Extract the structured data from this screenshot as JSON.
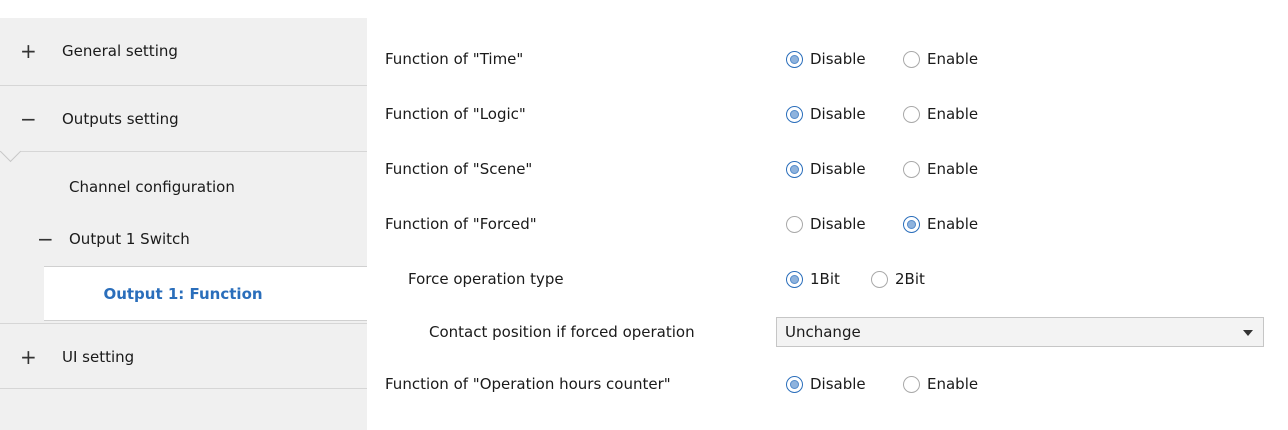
{
  "sidebar": {
    "general": {
      "expander": "+",
      "label": "General setting"
    },
    "outputs": {
      "expander": "−",
      "label": "Outputs setting"
    },
    "channel_config": {
      "label": "Channel configuration"
    },
    "output1_switch": {
      "expander": "−",
      "label": "Output 1 Switch"
    },
    "output1_function": {
      "label": "Output 1: Function"
    },
    "ui": {
      "expander": "+",
      "label": "UI setting"
    }
  },
  "params": {
    "time": {
      "label": "Function of \"Time\"",
      "options": [
        "Disable",
        "Enable"
      ],
      "selected": "Disable"
    },
    "logic": {
      "label": "Function of \"Logic\"",
      "options": [
        "Disable",
        "Enable"
      ],
      "selected": "Disable"
    },
    "scene": {
      "label": "Function of \"Scene\"",
      "options": [
        "Disable",
        "Enable"
      ],
      "selected": "Disable"
    },
    "forced": {
      "label": "Function of \"Forced\"",
      "options": [
        "Disable",
        "Enable"
      ],
      "selected": "Enable"
    },
    "force_type": {
      "label": "Force operation type",
      "options": [
        "1Bit",
        "2Bit"
      ],
      "selected": "1Bit"
    },
    "contact_position": {
      "label": "Contact position if forced operation",
      "value": "Unchange"
    },
    "hours_counter": {
      "label": "Function of \"Operation hours counter\"",
      "options": [
        "Disable",
        "Enable"
      ],
      "selected": "Disable"
    }
  },
  "colors": {
    "sidebar_bg": "#f0f0f0",
    "selected_text": "#2a6ebb",
    "radio_accent": "#2a6ebb"
  }
}
